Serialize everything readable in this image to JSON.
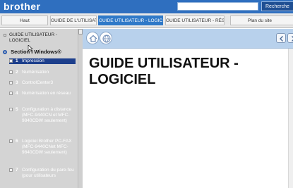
{
  "header": {
    "brand": "brother",
    "search_button": "Recherche"
  },
  "tabs": [
    {
      "label": "Haut"
    },
    {
      "label": "GUIDE DE L'UTILISATEUR"
    },
    {
      "label": "GUIDE UTILISATEUR - LOGICIEL",
      "active": true
    },
    {
      "label": "GUIDE UTILISATEUR - RÉSEAU"
    },
    {
      "label": "Plan du site"
    }
  ],
  "sidebar": {
    "guide_link": "GUIDE UTILISATEUR - LOGICIEL",
    "section_title": "Section I Windows®",
    "items": [
      {
        "num": "1",
        "label": "Impression",
        "selected": true
      },
      {
        "num": "2",
        "label": "Numérisation"
      },
      {
        "num": "3",
        "label": "ControlCenter3"
      },
      {
        "num": "4",
        "label": "Numérisation en réseau"
      },
      {
        "num": "5",
        "label": "Configuration à distance (MFC-9440CN et MFC-9840CDW seulement)"
      },
      {
        "num": "6",
        "label": "Logiciel Brother PC-FAX (MFC-9440CNet MFC-9840CDW seulement)"
      },
      {
        "num": "7",
        "label": "Configuration du pare-feu (pour utilisateurs"
      }
    ]
  },
  "content": {
    "title": "GUIDE UTILISATEUR - LOGICIEL"
  },
  "colors": {
    "brand_blue": "#2f6fbf",
    "active_tab": "#2f79c8",
    "sidebar_bg": "#d4d4d4",
    "selected_item": "#1d3f8c"
  }
}
